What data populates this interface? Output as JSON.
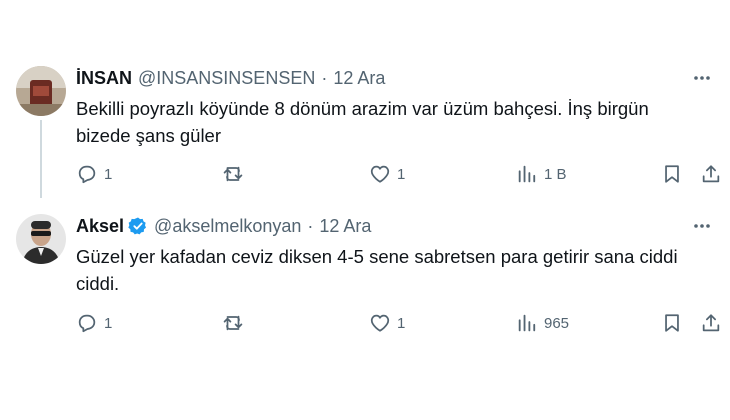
{
  "tweets": [
    {
      "name": "İNSAN",
      "handle": "@INSANSINSENSEN",
      "separator": "·",
      "date": "12 Ara",
      "text": "Bekilli poyrazlı köyünde 8 dönüm arazim var üzüm bahçesi. İnş birgün bizede şans güler",
      "replies": "1",
      "reposts": "",
      "likes": "1",
      "views": "1 B",
      "verified": false
    },
    {
      "name": "Aksel",
      "handle": "@akselmelkonyan",
      "separator": "·",
      "date": "12 Ara",
      "text": "Güzel yer kafadan ceviz diksen 4-5 sene sabretsen para getirir sana ciddi ciddi.",
      "replies": "1",
      "reposts": "",
      "likes": "1",
      "views": "965",
      "verified": true
    }
  ],
  "colors": {
    "text": "#0f1419",
    "secondary": "#536471",
    "verified_blue": "#1d9bf0",
    "thread_line": "#cfd9de"
  },
  "icons": [
    "reply-icon",
    "repost-icon",
    "like-icon",
    "views-icon",
    "bookmark-icon",
    "share-icon",
    "more-icon",
    "verified-icon"
  ]
}
